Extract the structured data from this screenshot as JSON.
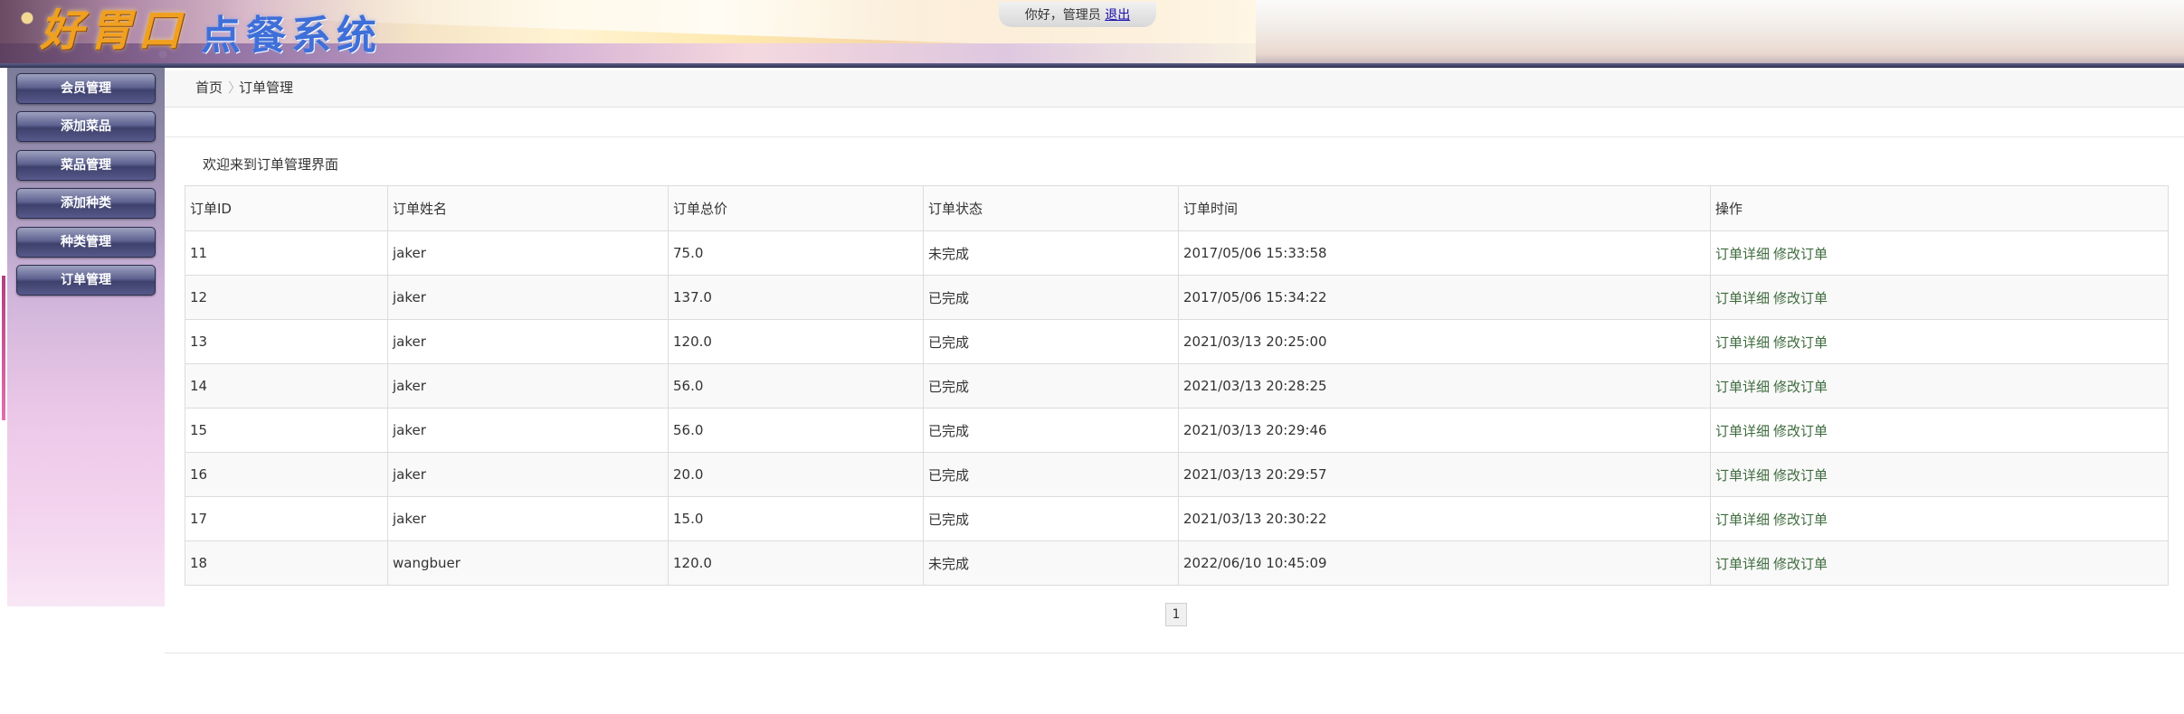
{
  "header": {
    "logo_mark": "好胃口",
    "logo_system": "点餐系统",
    "greeting": "你好，管理员",
    "logout_label": "退出"
  },
  "sidebar": {
    "items": [
      {
        "label": "会员管理"
      },
      {
        "label": "添加菜品"
      },
      {
        "label": "菜品管理"
      },
      {
        "label": "添加种类"
      },
      {
        "label": "种类管理"
      },
      {
        "label": "订单管理"
      }
    ]
  },
  "breadcrumb": {
    "home": "首页",
    "separator": "〉",
    "current": "订单管理"
  },
  "main": {
    "welcome": "欢迎来到订单管理界面",
    "table": {
      "headers": [
        "订单ID",
        "订单姓名",
        "订单总价",
        "订单状态",
        "订单时间",
        "操作"
      ],
      "rows": [
        {
          "id": "11",
          "name": "jaker",
          "total": "75.0",
          "status": "未完成",
          "time": "2017/05/06 15:33:58"
        },
        {
          "id": "12",
          "name": "jaker",
          "total": "137.0",
          "status": "已完成",
          "time": "2017/05/06 15:34:22"
        },
        {
          "id": "13",
          "name": "jaker",
          "total": "120.0",
          "status": "已完成",
          "time": "2021/03/13 20:25:00"
        },
        {
          "id": "14",
          "name": "jaker",
          "total": "56.0",
          "status": "已完成",
          "time": "2021/03/13 20:28:25"
        },
        {
          "id": "15",
          "name": "jaker",
          "total": "56.0",
          "status": "已完成",
          "time": "2021/03/13 20:29:46"
        },
        {
          "id": "16",
          "name": "jaker",
          "total": "20.0",
          "status": "已完成",
          "time": "2021/03/13 20:29:57"
        },
        {
          "id": "17",
          "name": "jaker",
          "total": "15.0",
          "status": "已完成",
          "time": "2021/03/13 20:30:22"
        },
        {
          "id": "18",
          "name": "wangbuer",
          "total": "120.0",
          "status": "未完成",
          "time": "2022/06/10 10:45:09"
        }
      ],
      "actions": {
        "detail": "订单详细",
        "edit": "修改订单"
      }
    },
    "pagination": {
      "current_page": "1"
    }
  },
  "colors": {
    "nav_button": "#4a4e7c",
    "action_link": "#3e6b3e",
    "logout_link": "#1a0dab"
  }
}
